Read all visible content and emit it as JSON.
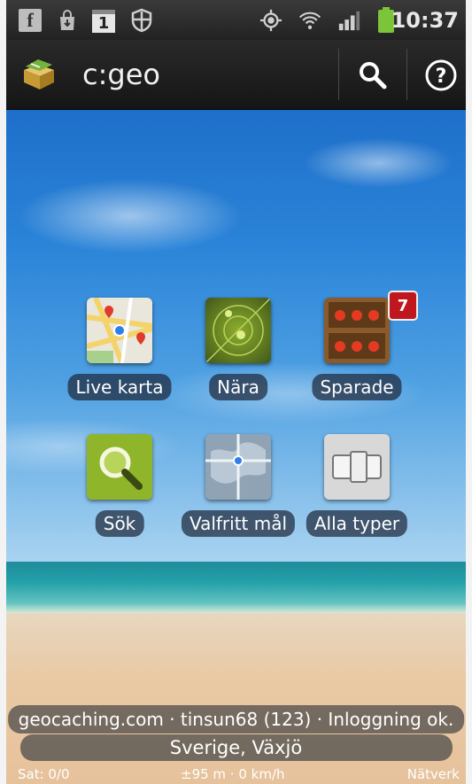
{
  "statusbar": {
    "time": "10:37",
    "calendar_day": "1",
    "icons": [
      "facebook-icon",
      "shopping-bag-icon",
      "calendar-icon",
      "shield-icon",
      "gps-icon",
      "wifi-icon",
      "signal-icon",
      "battery-icon"
    ]
  },
  "actionbar": {
    "title": "c:geo",
    "search_icon": "search-icon",
    "help_icon": "help-icon"
  },
  "menu": [
    {
      "label": "Live karta",
      "icon": "map-icon"
    },
    {
      "label": "Nära",
      "icon": "radar-icon"
    },
    {
      "label": "Sparade",
      "icon": "stored-caches-icon",
      "badge": "7"
    },
    {
      "label": "Sök",
      "icon": "magnifier-icon"
    },
    {
      "label": "Valfritt mål",
      "icon": "globe-target-icon"
    },
    {
      "label": "Alla typer",
      "icon": "filter-switch-icon"
    }
  ],
  "status": {
    "login": "geocaching.com · tinsun68 (123) · Inloggning ok.",
    "location": "Sverige, Växjö",
    "satellites": "Sat: 0/0",
    "accuracy": "±95 m · 0 km/h",
    "provider": "Nätverk"
  },
  "colors": {
    "badge": "#c0161d",
    "sky": "#2b84d8",
    "sea": "#23a0a8",
    "sand": "#e6c29c",
    "actionbar": "#1c1c1c"
  }
}
